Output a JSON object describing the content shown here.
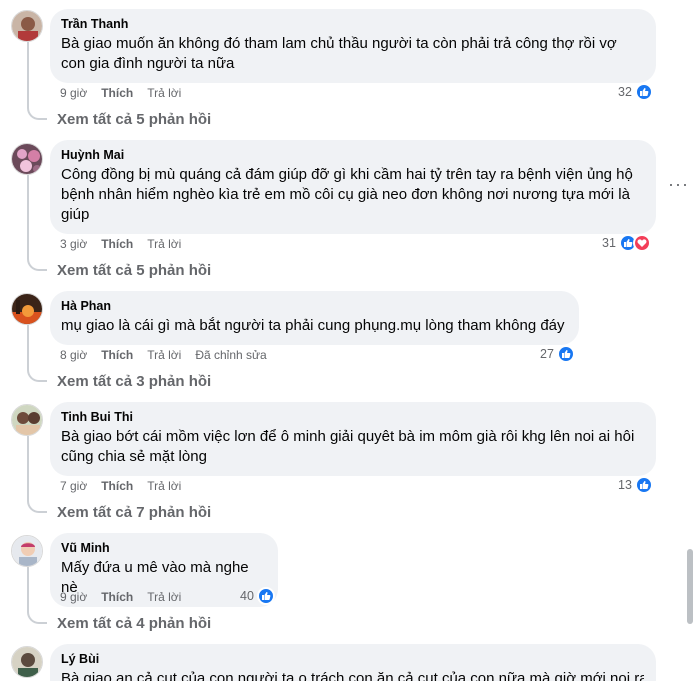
{
  "colors": {
    "bubble": "#f0f2f5",
    "like": "#1877f2",
    "love": "#f33e58",
    "meta": "#65676b"
  },
  "comments": [
    {
      "author": "Trần Thanh",
      "text": "Bà giao muốn ăn không đó tham lam chủ thầu người ta còn phải trả công thợ rồi vợ con gia đình người ta nữa",
      "time": "9 giờ",
      "like_label": "Thích",
      "reply_label": "Trả lời",
      "edited": "",
      "reaction_count": "32",
      "view_replies": "Xem tất cả 5 phản hồi",
      "reactions": [
        "like-icon"
      ]
    },
    {
      "author": "Huỳnh Mai",
      "text": "Công đồng bị mù quáng cả đám giúp đỡ gì khi cầm hai tỷ trên tay ra bệnh viện ủng hộ bệnh nhân hiểm nghèo kìa trẻ em mồ côi cụ già neo đơn không nơi nương tựa mới là giúp",
      "time": "3 giờ",
      "like_label": "Thích",
      "reply_label": "Trả lời",
      "edited": "",
      "reaction_count": "31",
      "view_replies": "Xem tất cả 5 phản hồi",
      "reactions": [
        "like-icon",
        "love-icon"
      ],
      "more_label": "···"
    },
    {
      "author": "Hà Phan",
      "text": "mụ giao là cái gì mà bắt người ta phải cung phụng.mụ lòng tham không đáy",
      "time": "8 giờ",
      "like_label": "Thích",
      "reply_label": "Trả lời",
      "edited": "Đã chỉnh sửa",
      "reaction_count": "27",
      "view_replies": "Xem tất cả 3 phản hồi",
      "reactions": [
        "like-icon"
      ]
    },
    {
      "author": "Tinh Bui Thi",
      "text": "Bà giao bớt cái mồm việc lơn để ô minh giải quyêt bà im môm già rôi khg lên noi ai hôi cũng chia sẻ mặt lòng",
      "time": "7 giờ",
      "like_label": "Thích",
      "reply_label": "Trả lời",
      "edited": "",
      "reaction_count": "13",
      "view_replies": "Xem tất cả 7 phản hồi",
      "reactions": [
        "like-icon"
      ]
    },
    {
      "author": "Vũ Minh",
      "text": "Mấy đứa u mê vào mà nghe nè",
      "time": "9 giờ",
      "like_label": "Thích",
      "reply_label": "Trả lời",
      "edited": "",
      "reaction_count": "40",
      "view_replies": "Xem tất cả 4 phản hồi",
      "reactions": [
        "like-icon"
      ]
    },
    {
      "author": "Lý Bùi",
      "text": "Bà giao an cả cut của con người ta o trách con ăn cả cut của con nữa mà giờ mới noi ra",
      "time": "",
      "like_label": "",
      "reply_label": "",
      "edited": "",
      "reaction_count": "",
      "view_replies": "",
      "reactions": []
    }
  ]
}
